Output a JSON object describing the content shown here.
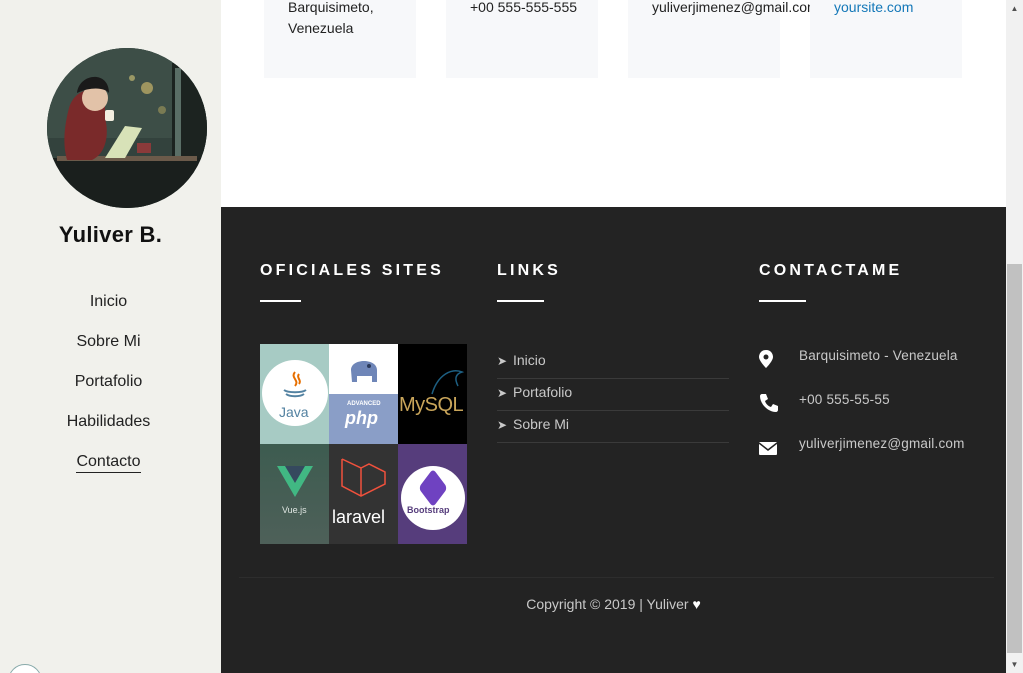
{
  "sidebar": {
    "brand": "Yuliver B.",
    "nav": [
      {
        "label": "Inicio",
        "active": false
      },
      {
        "label": "Sobre Mi",
        "active": false
      },
      {
        "label": "Portafolio",
        "active": false
      },
      {
        "label": "Habilidades",
        "active": false
      },
      {
        "label": "Contacto",
        "active": true
      }
    ]
  },
  "info_cards": [
    {
      "text": "Barquisimeto, Venezuela",
      "icon": "location"
    },
    {
      "text": "+00 555-555-555",
      "icon": "phone"
    },
    {
      "text": "yuliverjimenez@gmail.com",
      "icon": "email"
    },
    {
      "text": "yoursite.com",
      "icon": "globe",
      "link": true
    }
  ],
  "footer": {
    "col1_title": "OFICIALES SITES",
    "col2_title": "LINKS",
    "col3_title": "CONTACTAME",
    "tiles": {
      "java": "Java",
      "php_small": "ADVANCED",
      "php": "php",
      "mysql": "MySQL",
      "vue": "Vue.js",
      "laravel": "laravel",
      "bootstrap": "Bootstrap"
    },
    "links": [
      "Inicio",
      "Portafolio",
      "Sobre Mi"
    ],
    "contact": {
      "address": "Barquisimeto - Venezuela",
      "phone": "+00 555-55-55",
      "email": "yuliverjimenez@gmail.com"
    },
    "copyright": "Copyright © 2019 | Yuliver"
  },
  "colors": {
    "sidebar_bg": "#f1f1ec",
    "footer_bg": "#232323",
    "link_blue": "#1478b8",
    "card_bg": "#f7f8fa"
  }
}
